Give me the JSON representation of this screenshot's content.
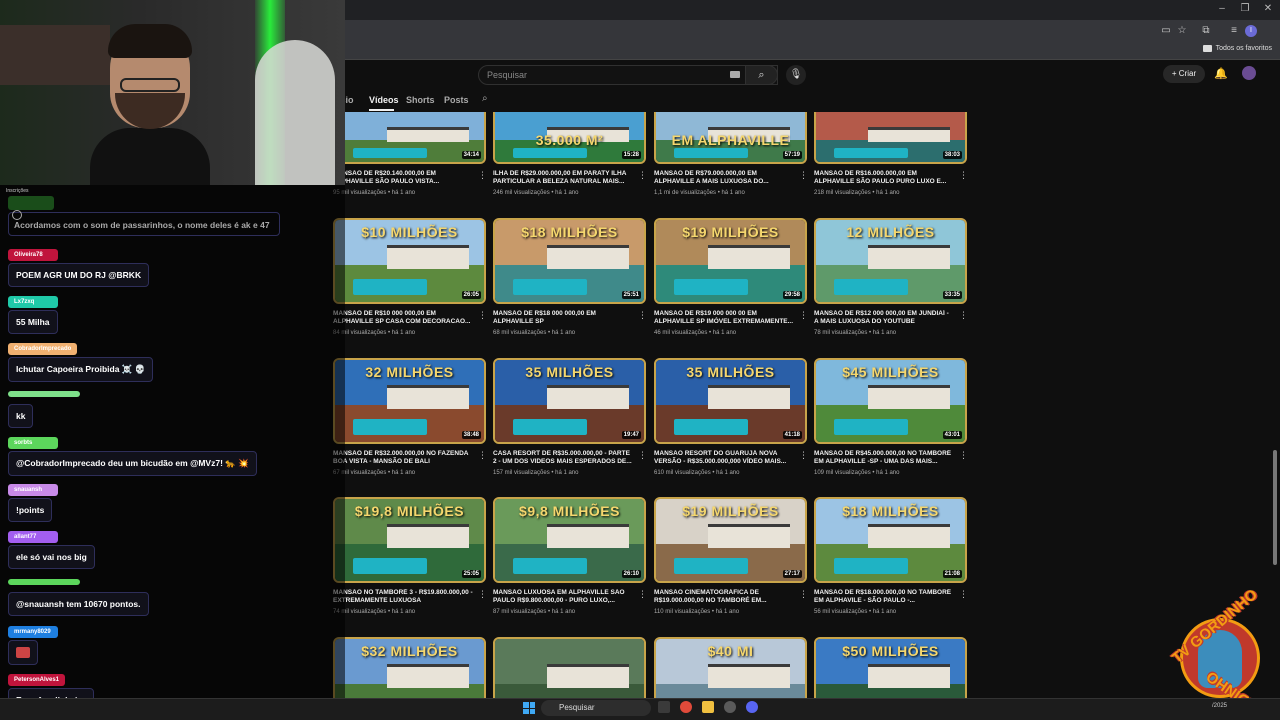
{
  "youtube": {
    "search_placeholder": "Pesquisar",
    "create_label": "Criar",
    "tabs": [
      "Início",
      "Vídeos",
      "Shorts",
      "Posts"
    ],
    "active_tab": "Vídeos"
  },
  "bookmarks": {
    "all_bookmarks": "Todos os favoritos"
  },
  "videos": [
    {
      "title": "MANSÃO DE R$20.140.000,00 EM ALPHAVILLE SÃO PAULO VISTA...",
      "meta": "95 mil visualizações • há 1 ano",
      "duration": "34:14",
      "thumb_text": "",
      "sky": "#7fb0d9",
      "ground": "#4f7d3a"
    },
    {
      "title": "ILHA DE R$29.000.000,00 EM PARATY ILHA PARTICULAR A BELEZA NATURAL MAIS...",
      "meta": "246 mil visualizações • há 1 ano",
      "duration": "15:28",
      "thumb_text": "35.000 M²",
      "sky": "#4a9fd1",
      "ground": "#2f7a3b"
    },
    {
      "title": "MANSÃO DE R$79.000.000,00 EM ALPHAVILLE A MAIS LUXUOSA DO...",
      "meta": "1,1 mi de visualizações • há 1 ano",
      "duration": "57:19",
      "thumb_text": "EM ALPHAVILLE",
      "sky": "#8fb8d6",
      "ground": "#3f7a4a"
    },
    {
      "title": "MANSÃO DE R$16.000.000,00 EM ALPHAVILLE SÃO PAULO PURO LUXO E...",
      "meta": "218 mil visualizações • há 1 ano",
      "duration": "38:03",
      "thumb_text": "",
      "sky": "#b45a4a",
      "ground": "#2c6e6e"
    },
    {
      "title": "MANSÃO DE R$10 000 000,00 EM ALPHAVILLE SP CASA COM DECORACAO...",
      "meta": "84 mil visualizações • há 1 ano",
      "duration": "26:05",
      "thumb_text": "$10 MILHÕES",
      "sky": "#9cc4e4",
      "ground": "#5d8a3e"
    },
    {
      "title": "MANSÃO DE R$18 000 000,00 EM ALPHAVILLE SP",
      "meta": "68 mil visualizações • há 1 ano",
      "duration": "25:51",
      "thumb_text": "$18 MILHÕES",
      "sky": "#c89a6a",
      "ground": "#3f8a8a"
    },
    {
      "title": "MANSÃO DE R$19 000 000 00 EM ALPHAVILLE SP IMÓVEL EXTREMAMENTE...",
      "meta": "46 mil visualizações • há 1 ano",
      "duration": "29:58",
      "thumb_text": "$19 MILHÕES",
      "sky": "#b08a5a",
      "ground": "#2e8a7a"
    },
    {
      "title": "MANSÃO DE R$12 000 000,00 EM JUNDIAÍ - A MAIS LUXUOSA DO YOUTUBE",
      "meta": "78 mil visualizações • há 1 ano",
      "duration": "33:35",
      "thumb_text": "12 MILHÕES",
      "sky": "#8fc6d8",
      "ground": "#5f9a6a"
    },
    {
      "title": "MANSÃO DE R$32.000.000,00 NO FAZENDA BOA VISTA - MANSÃO DE BALI",
      "meta": "67 mil visualizações • há 1 ano",
      "duration": "38:48",
      "thumb_text": "32 MILHÕES",
      "sky": "#2f6fb8",
      "ground": "#8a4a2e"
    },
    {
      "title": "CASA RESORT DE R$35.000.000,00 - PARTE 2 - UM DOS VIDEOS MAIS ESPERADOS DE...",
      "meta": "157 mil visualizações • há 1 ano",
      "duration": "19:47",
      "thumb_text": "35 MILHÕES",
      "sky": "#2a5fa8",
      "ground": "#6a3a2a"
    },
    {
      "title": "MANSÃO RESORT DO GUARUJÁ NOVA VERSÃO - R$35.000.000,000 VÍDEO MAIS...",
      "meta": "610 mil visualizações • há 1 ano",
      "duration": "41:18",
      "thumb_text": "35 MILHÕES",
      "sky": "#2a5fa8",
      "ground": "#6a3a2a"
    },
    {
      "title": "MANSÃO DE R$45.000.000,00 NO TAMBORÉ EM ALPHAVILLE -SP - UMA DAS MAIS...",
      "meta": "109 mil visualizações • há 1 ano",
      "duration": "43:01",
      "thumb_text": "$45 MILHÕES",
      "sky": "#7fb8dc",
      "ground": "#4f8a3a"
    },
    {
      "title": "MANSÃO NO TAMBORÉ 3 - R$19.800.000,00 - EXTREMAMENTE LUXUOSA",
      "meta": "74 mil visualizações • há 1 ano",
      "duration": "25:05",
      "thumb_text": "$19,8 MILHÕES",
      "sky": "#5f8a4a",
      "ground": "#2f6a3a"
    },
    {
      "title": "MANSÃO LUXUOSA EM ALPHAVILLE SÃO PAULO R$9.800.000,00 - PURO LUXO,...",
      "meta": "87 mil visualizações • há 1 ano",
      "duration": "26:10",
      "thumb_text": "$9,8 MILHÕES",
      "sky": "#6a9a5a",
      "ground": "#3a6a4a"
    },
    {
      "title": "MANSÃO CINEMATOGRÁFICA DE R$19.000.000,00 NO TAMBORÉ EM...",
      "meta": "110 mil visualizações • há 1 ano",
      "duration": "27:17",
      "thumb_text": "$19 MILHÕES",
      "sky": "#d8d2c8",
      "ground": "#8a6a4a"
    },
    {
      "title": "MANSÃO DE R$18.000.000,00 NO TAMBORÉ EM ALPHAVILE - SÃO PAULO -...",
      "meta": "56 mil visualizações • há 1 ano",
      "duration": "21:08",
      "thumb_text": "$18 MILHÕES",
      "sky": "#9cc4e4",
      "ground": "#5d8a3e"
    },
    {
      "title": "",
      "meta": "",
      "duration": "",
      "thumb_text": "$32 MILHÕES",
      "sky": "#6a9ad0",
      "ground": "#4a7a3a"
    },
    {
      "title": "",
      "meta": "",
      "duration": "",
      "thumb_text": "",
      "sky": "#5a7a5a",
      "ground": "#3a5a3a"
    },
    {
      "title": "",
      "meta": "",
      "duration": "",
      "thumb_text": "$40 MI",
      "sky": "#b8c8d8",
      "ground": "#6a8a9a"
    },
    {
      "title": "",
      "meta": "",
      "duration": "",
      "thumb_text": "$50 MILHÕES",
      "sky": "#3a7ac4",
      "ground": "#2a5a3a"
    }
  ],
  "chat": {
    "section_label": "Inscrições",
    "top_message": "Acordamos com o som de passarinhos, o nome deles é ak e 47",
    "messages": [
      {
        "name": "Oliveira78",
        "text": "POEM AGR UM DO RJ @BRKK",
        "color": "#c0143c"
      },
      {
        "name": "Lx7zxq",
        "text": "55 Milha",
        "color": "#1fc9a8"
      },
      {
        "name": "CobradorImprecado",
        "text": "Ichutar Capoeira Proibida ☠️ 💀",
        "color": "#f0b070"
      },
      {
        "name": "",
        "text": "kk",
        "color": "#7ee08a"
      },
      {
        "name": "sorbts",
        "text": "@CobradorImprecado deu um bicudão em @MVz7! 🐆 💥",
        "color": "#5cd65c"
      },
      {
        "name": "snauansh",
        "text": "!points",
        "color": "#c88ae8"
      },
      {
        "name": "allant77",
        "text": "ele só vai nos big",
        "color": "#a35ef0"
      },
      {
        "name": "",
        "text": "@snauansh tem 10670 pontos.",
        "color": "#5cd65c"
      },
      {
        "name": "mrmany8029",
        "text": "",
        "color": "#1e7fe0"
      },
      {
        "name": "PetersonAlves1",
        "text": "Esse faz dinheiro",
        "color": "#c0143c"
      }
    ]
  },
  "watermark": {
    "line1": "TV GORDINHO",
    "line2": "TV GORDINHO"
  },
  "taskbar": {
    "search_label": "Pesquisar",
    "time": "/2025"
  }
}
